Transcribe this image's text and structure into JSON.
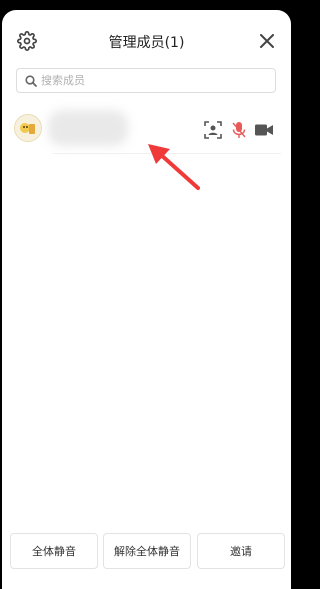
{
  "header": {
    "title": "管理成员(1)"
  },
  "search": {
    "placeholder": "搜索成员",
    "value": ""
  },
  "members": [
    {
      "name": ""
    }
  ],
  "footer": {
    "mute_all_label": "全体静音",
    "unmute_all_label": "解除全体静音",
    "invite_label": "邀请"
  },
  "colors": {
    "mic_muted": "#e85a5a",
    "icon_gray": "#555555",
    "arrow_red": "#f03a3a"
  }
}
